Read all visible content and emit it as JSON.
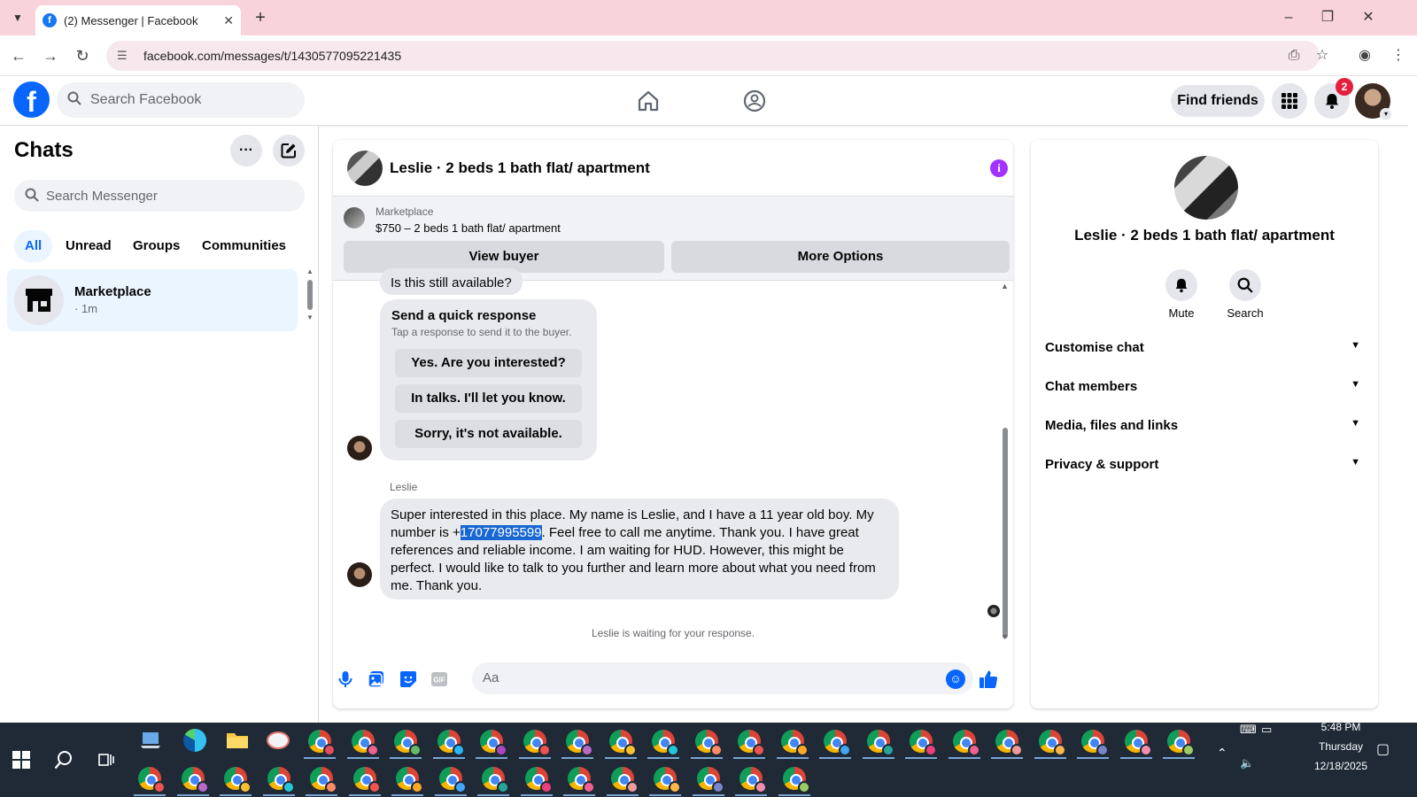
{
  "browser": {
    "tab_title": "(2) Messenger | Facebook",
    "url": "facebook.com/messages/t/1430577095221435"
  },
  "fb_header": {
    "search_placeholder": "Search Facebook",
    "find_friends": "Find friends",
    "notification_count": "2"
  },
  "sidebar": {
    "title": "Chats",
    "search_placeholder": "Search Messenger",
    "filters": [
      "All",
      "Unread",
      "Groups",
      "Communities"
    ],
    "active_filter": "All",
    "chats": [
      {
        "name": "Marketplace",
        "time": "· 1m"
      }
    ]
  },
  "conversation": {
    "title": "Leslie · 2 beds 1 bath flat/ apartment",
    "marketplace_label": "Marketplace",
    "listing": "$750 – 2 beds 1 bath flat/ apartment",
    "view_buyer": "View buyer",
    "more_options": "More Options",
    "partial_message": "Is this still available?",
    "quick_response": {
      "heading": "Send a quick response",
      "subtext": "Tap a response to send it to the buyer.",
      "options": [
        "Yes. Are you interested?",
        "In talks. I'll let you know.",
        "Sorry, it's not available."
      ]
    },
    "sender": "Leslie",
    "message_before": "Super interested in this place. My name is Leslie, and I have a 11 year old boy. My number is +",
    "message_highlight": "17077995599",
    "message_after": ". Feel free to call me anytime. Thank you. I have great references and reliable income. I am waiting for HUD. However, this might be perfect. I would like to talk to you further and learn more about what you need from me. Thank you.",
    "waiting_text": "Leslie is waiting for your response.",
    "composer_placeholder": "Aa"
  },
  "details": {
    "name": "Leslie · 2 beds 1 bath flat/ apartment",
    "mute": "Mute",
    "search": "Search",
    "sections": [
      "Customise chat",
      "Chat members",
      "Media, files and links",
      "Privacy & support"
    ]
  },
  "taskbar": {
    "time": "5:48 PM",
    "day": "Thursday",
    "date": "12/18/2025"
  },
  "colors": {
    "fb_blue": "#0866ff",
    "info_purple": "#a033ff",
    "tab_bar": "#f9d3dc",
    "highlight": "#1967d2"
  }
}
